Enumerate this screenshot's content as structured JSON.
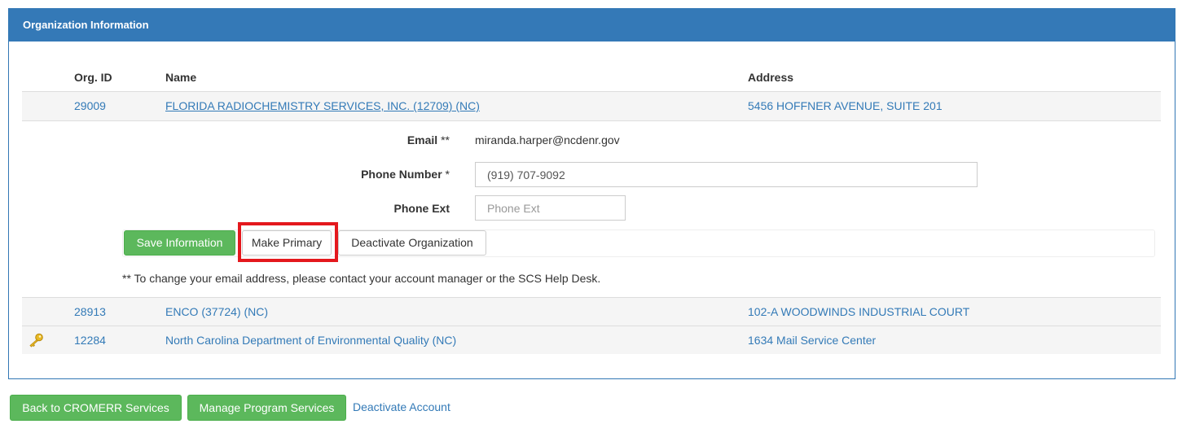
{
  "panel": {
    "title": "Organization Information"
  },
  "table": {
    "headers": {
      "org_id": "Org. ID",
      "name": "Name",
      "address": "Address"
    },
    "rows": [
      {
        "org_id": "29009",
        "name": "FLORIDA RADIOCHEMISTRY SERVICES, INC. (12709) (NC)",
        "address": "5456 HOFFNER AVENUE, SUITE 201"
      },
      {
        "org_id": "28913",
        "name": "ENCO (37724) (NC)",
        "address": "102-A WOODWINDS INDUSTRIAL COURT"
      },
      {
        "org_id": "12284",
        "name": "North Carolina Department of Environmental Quality (NC)",
        "address": "1634 Mail Service Center",
        "primary": true,
        "icon": "key-icon"
      }
    ]
  },
  "form": {
    "email_label": "Email",
    "email_marker": "**",
    "email_value": "miranda.harper@ncdenr.gov",
    "phone_label": "Phone Number",
    "phone_marker": "*",
    "phone_value": "(919) 707-9092",
    "ext_label": "Phone Ext",
    "ext_placeholder": "Phone Ext",
    "ext_value": ""
  },
  "buttons": {
    "save": "Save Information",
    "make_primary": "Make Primary",
    "deactivate_org": "Deactivate Organization"
  },
  "note": "** To change your email address, please contact your account manager or the SCS Help Desk.",
  "footer": {
    "back": "Back to CROMERR Services",
    "manage": "Manage Program Services",
    "deactivate_account": "Deactivate Account"
  },
  "colors": {
    "header_bg": "#3479b7",
    "link": "#337ab7",
    "success": "#5cb85c",
    "highlight": "#e4181d",
    "key_icon": "#e8b923"
  }
}
